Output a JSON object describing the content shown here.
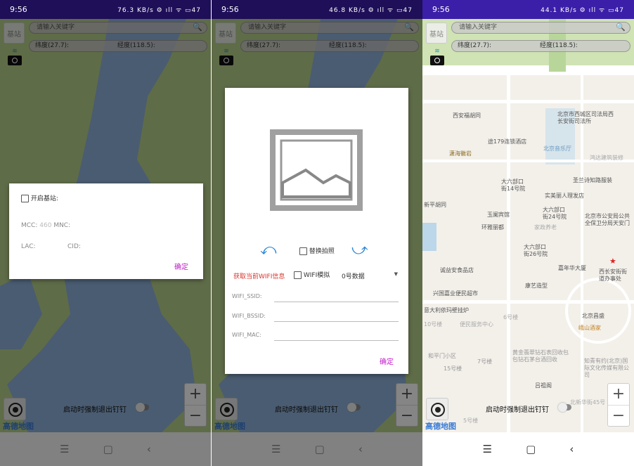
{
  "status": {
    "time": "9:56",
    "speeds": [
      "76.3 KB/s",
      "46.8 KB/s",
      "44.1 KB/s"
    ],
    "battery": "47"
  },
  "toolbar": {
    "base_station_button": "基站",
    "search_placeholder": "请输入关键字",
    "latitude": "纬度(27.7):",
    "longitude": "经度(118.5):"
  },
  "map": {
    "logo": "高德地图",
    "force_quit_label": "启动时强制退出钉钉",
    "force_quit_enabled": false,
    "zoom_in": "+",
    "zoom_out": "−",
    "labels": [
      "西安福胡同",
      "北京市西城区司法局西长安街司法所",
      "途179连锁酒店",
      "北京音乐厅",
      "潇海徽岩",
      "鸿达建筑装修",
      "大六部口街14号院",
      "圣兰诗知路服装",
      "实美丽人理发店",
      "新平胡同",
      "玉阑宾馆",
      "大六部口街24号院",
      "北京市公安局公共全保卫分局天安门",
      "环雅丽都",
      "家政养老",
      "大六部口街26号院",
      "嘉年华大厦",
      "西长安街街道办事处",
      "诚益安食品店",
      "康艺造型",
      "兴国嘉业便民超市",
      "意大利依玛壁挂炉",
      "6号楼",
      "10号楼",
      "便民服务中心",
      "北京昌盛",
      "峨山酒家",
      "和平门小区",
      "7号楼",
      "黄金翡翠钻石表回收包包钻石茅台酒回收",
      "15号楼",
      "知青有约(北京)国际文化传媒有限公司",
      "吕祖阁",
      "北新华街45号",
      "5号楼"
    ]
  },
  "navbar": {
    "menu": "☰",
    "home": "▢",
    "back": "‹"
  },
  "base_station_dialog": {
    "enable_label": "开启基站:",
    "enabled": false,
    "mcc_label": "MCC:",
    "mcc_value": "460",
    "mnc_label": "MNC:",
    "lac_label": "LAC:",
    "cid_label": "CID:",
    "confirm": "确定"
  },
  "wifi_dialog": {
    "replace_photo_label": "替换拍照",
    "replace_photo": false,
    "get_wifi_button": "获取当前WIFI信息",
    "wifi_sim_label": "WIFI模拟",
    "wifi_sim": false,
    "data_select": "0号数据",
    "ssid_label": "WIFI_SSID:",
    "bssid_label": "WIFI_BSSID:",
    "mac_label": "WIFI_MAC:",
    "confirm": "确定"
  },
  "colors": {
    "status_bar": "#3b1fa8",
    "accent": "#c020c8",
    "get_wifi": "#d9342b",
    "arrow": "#2a86d6"
  }
}
